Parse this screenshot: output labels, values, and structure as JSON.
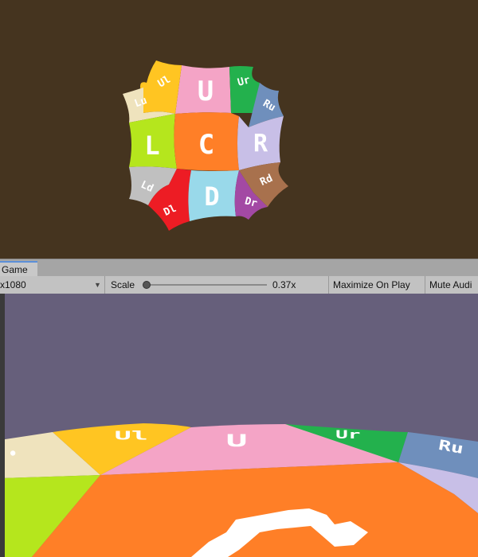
{
  "scene": {
    "tiles": [
      {
        "id": "U",
        "label": "U",
        "color": "#f4a4c6"
      },
      {
        "id": "Ul",
        "label": "Ul",
        "color": "#ffc522"
      },
      {
        "id": "Ur",
        "label": "Ur",
        "color": "#23b14d"
      },
      {
        "id": "Ru",
        "label": "Ru",
        "color": "#6f8fbc"
      },
      {
        "id": "Lu",
        "label": "Lu",
        "color": "#efe3bd"
      },
      {
        "id": "L",
        "label": "L",
        "color": "#b5e61d"
      },
      {
        "id": "C",
        "label": "C",
        "color": "#ff7f27"
      },
      {
        "id": "R",
        "label": "R",
        "color": "#c8bfe7"
      },
      {
        "id": "Ld",
        "label": "Ld",
        "color": "#c0c0c0"
      },
      {
        "id": "Rd",
        "label": "Rd",
        "color": "#a8714d"
      },
      {
        "id": "Dl",
        "label": "Dl",
        "color": "#ed1c24"
      },
      {
        "id": "D",
        "label": "D",
        "color": "#99d9ea"
      },
      {
        "id": "Dr",
        "label": "Dr",
        "color": "#a349a4"
      }
    ],
    "background_color": "#45341f"
  },
  "game_window": {
    "tab_label": "Game",
    "toolbar": {
      "resolution": "x1080",
      "scale_label": "Scale",
      "scale_value": "0.37x",
      "scale_fraction": 0.0,
      "maximize_label": "Maximize On Play",
      "mute_label": "Mute Audi"
    },
    "view": {
      "sky_color": "#665f7b",
      "floor_labels": {
        "Ul": "Ul",
        "U": "U",
        "Ur": "Ur",
        "Ru": "Ru"
      }
    }
  }
}
